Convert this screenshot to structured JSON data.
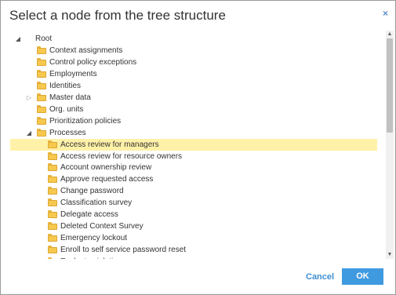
{
  "dialog": {
    "title": "Select a node from the tree structure",
    "close_label": "×"
  },
  "tree": {
    "items": [
      {
        "label": "Root",
        "depth": 0,
        "toggle": "expanded",
        "folder": false,
        "selected": false
      },
      {
        "label": "Context assignments",
        "depth": 1,
        "toggle": "none",
        "folder": true,
        "selected": false
      },
      {
        "label": "Control policy exceptions",
        "depth": 1,
        "toggle": "none",
        "folder": true,
        "selected": false
      },
      {
        "label": "Employments",
        "depth": 1,
        "toggle": "none",
        "folder": true,
        "selected": false
      },
      {
        "label": "Identities",
        "depth": 1,
        "toggle": "none",
        "folder": true,
        "selected": false
      },
      {
        "label": "Master data",
        "depth": 1,
        "toggle": "collapsed",
        "folder": true,
        "selected": false
      },
      {
        "label": "Org. units",
        "depth": 1,
        "toggle": "none",
        "folder": true,
        "selected": false
      },
      {
        "label": "Prioritization policies",
        "depth": 1,
        "toggle": "none",
        "folder": true,
        "selected": false
      },
      {
        "label": "Processes",
        "depth": 1,
        "toggle": "expanded",
        "folder": true,
        "selected": false
      },
      {
        "label": "Access review for managers",
        "depth": 2,
        "toggle": "none",
        "folder": true,
        "selected": true
      },
      {
        "label": "Access review for resource owners",
        "depth": 2,
        "toggle": "none",
        "folder": true,
        "selected": false
      },
      {
        "label": "Account ownership review",
        "depth": 2,
        "toggle": "none",
        "folder": true,
        "selected": false
      },
      {
        "label": "Approve requested access",
        "depth": 2,
        "toggle": "none",
        "folder": true,
        "selected": false
      },
      {
        "label": "Change password",
        "depth": 2,
        "toggle": "none",
        "folder": true,
        "selected": false
      },
      {
        "label": "Classification survey",
        "depth": 2,
        "toggle": "none",
        "folder": true,
        "selected": false
      },
      {
        "label": "Delegate access",
        "depth": 2,
        "toggle": "none",
        "folder": true,
        "selected": false
      },
      {
        "label": "Deleted Context Survey",
        "depth": 2,
        "toggle": "none",
        "folder": true,
        "selected": false
      },
      {
        "label": "Emergency lockout",
        "depth": 2,
        "toggle": "none",
        "folder": true,
        "selected": false
      },
      {
        "label": "Enroll to self service password reset",
        "depth": 2,
        "toggle": "none",
        "folder": true,
        "selected": false
      },
      {
        "label": "Evaluate violation",
        "depth": 2,
        "toggle": "none",
        "folder": true,
        "selected": false
      }
    ]
  },
  "icons": {
    "expanded": "◢",
    "collapsed": "▷",
    "scroll_up": "▲",
    "scroll_down": "▼"
  },
  "buttons": {
    "cancel_label": "Cancel",
    "ok_label": "OK"
  },
  "colors": {
    "accent": "#3f9ae0",
    "selected_row": "#fff1a8",
    "folder": "#f6c94e"
  }
}
